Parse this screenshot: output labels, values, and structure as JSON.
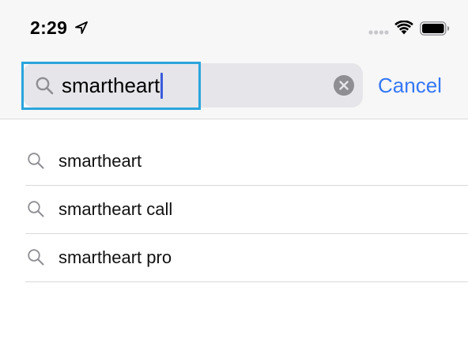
{
  "status_bar": {
    "time": "2:29",
    "icons": [
      "location-arrow-icon",
      "signal-icon",
      "wifi-icon",
      "battery-icon"
    ]
  },
  "search": {
    "value": "smartheart",
    "icon": "search-icon",
    "clear_icon": "clear-icon",
    "cancel_label": "Cancel"
  },
  "suggestions": [
    {
      "label": "smartheart",
      "icon": "search-icon"
    },
    {
      "label": "smartheart call",
      "icon": "search-icon"
    },
    {
      "label": "smartheart pro",
      "icon": "search-icon"
    }
  ],
  "colors": {
    "accent": "#3478f6",
    "focus_outline": "#2aa5dc",
    "search_field_bg": "#e5e5ea",
    "caret": "#3b5bdb"
  }
}
